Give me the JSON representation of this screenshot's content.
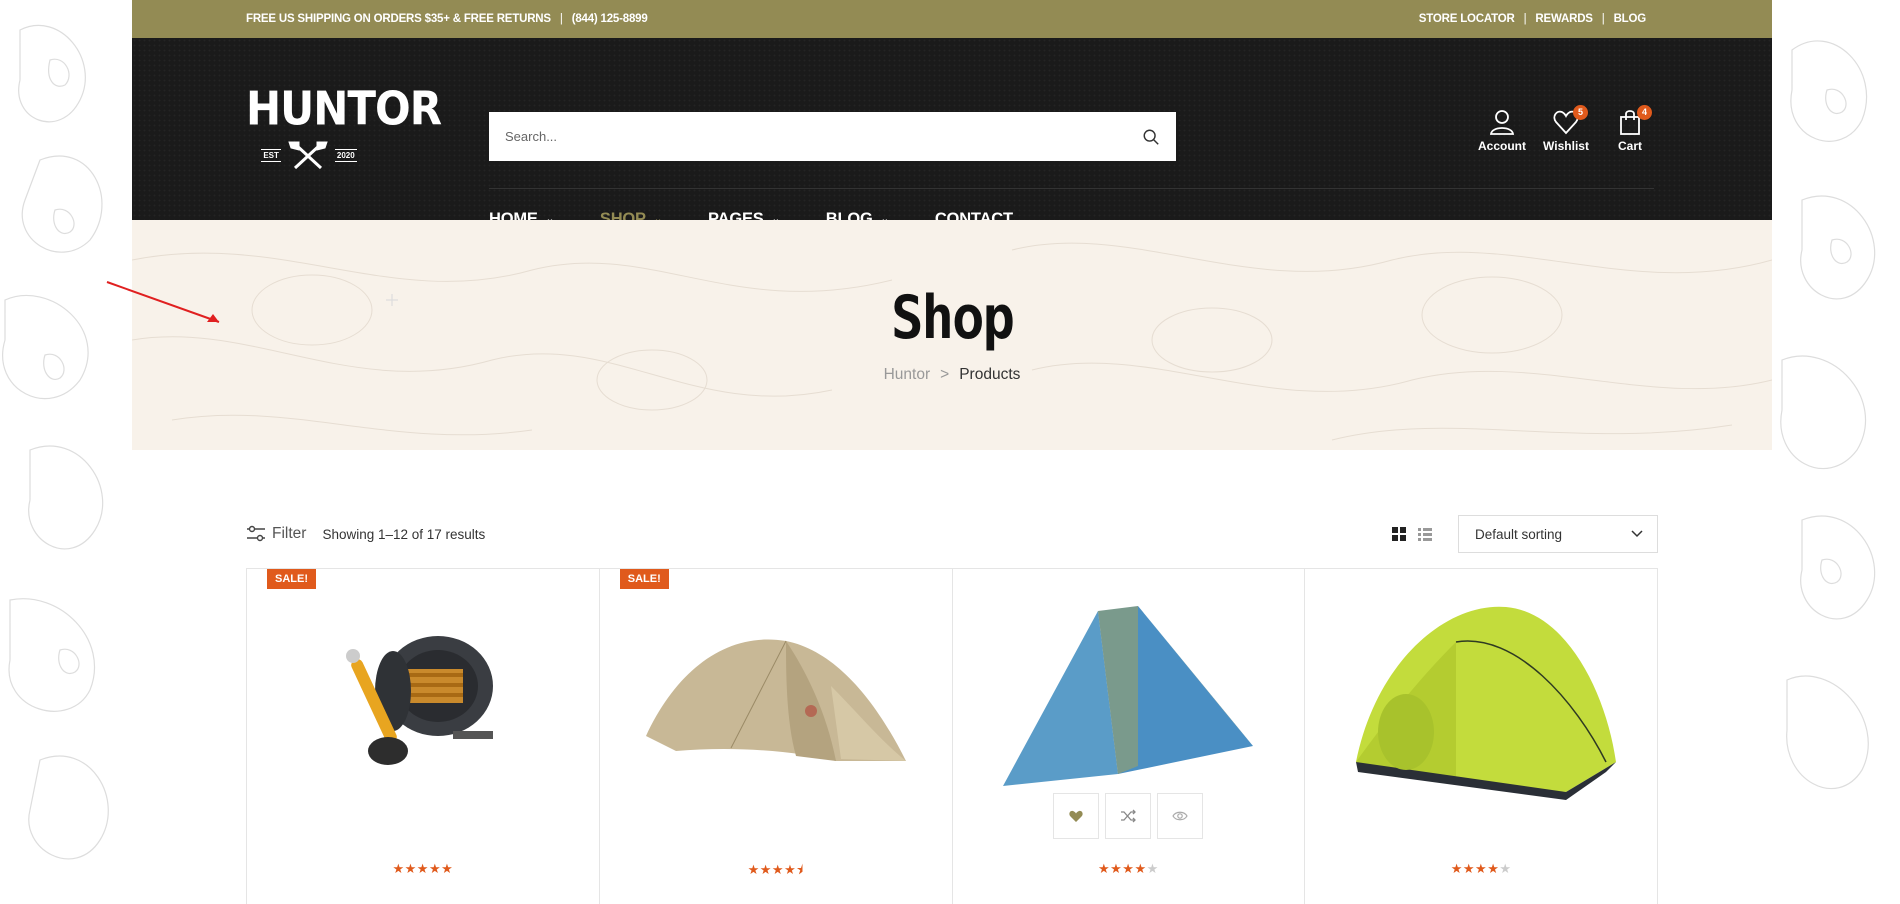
{
  "topbar": {
    "shipping": "FREE US SHIPPING ON ORDERS $35+ & FREE RETURNS",
    "phone": "(844) 125-8899",
    "links": [
      "STORE LOCATOR",
      "REWARDS",
      "BLOG"
    ]
  },
  "logo": {
    "word": "HUNTOR",
    "est": "EST",
    "year": "2020"
  },
  "search": {
    "placeholder": "Search..."
  },
  "header_icons": {
    "account": "Account",
    "wishlist": "Wishlist",
    "wishlist_count": "5",
    "cart": "Cart",
    "cart_count": "4"
  },
  "nav": {
    "items": [
      {
        "label": "HOME",
        "has_dropdown": true
      },
      {
        "label": "SHOP",
        "has_dropdown": true,
        "active": true
      },
      {
        "label": "PAGES",
        "has_dropdown": true
      },
      {
        "label": "BLOG",
        "has_dropdown": true
      },
      {
        "label": "CONTACT",
        "has_dropdown": false
      }
    ]
  },
  "hero": {
    "title": "Shop",
    "breadcrumb_home": "Huntor",
    "breadcrumb_sep": ">",
    "breadcrumb_current": "Products"
  },
  "toolbar": {
    "filter_label": "Filter",
    "results_text": "Showing 1–12 of 17 results",
    "sort_value": "Default sorting"
  },
  "products": [
    {
      "badge": "SALE!",
      "image": "fishing-reel",
      "rating": 5
    },
    {
      "badge": "SALE!",
      "image": "beige-tent",
      "rating": 4.5
    },
    {
      "badge": "",
      "image": "blue-tarp-tent",
      "rating": 4
    },
    {
      "badge": "",
      "image": "green-dome-tent",
      "rating": 4
    }
  ],
  "colors": {
    "accent": "#938b54",
    "badge": "#e05a1c",
    "header_bg": "#1a1a1a",
    "hero_bg": "#f8f2ea"
  }
}
